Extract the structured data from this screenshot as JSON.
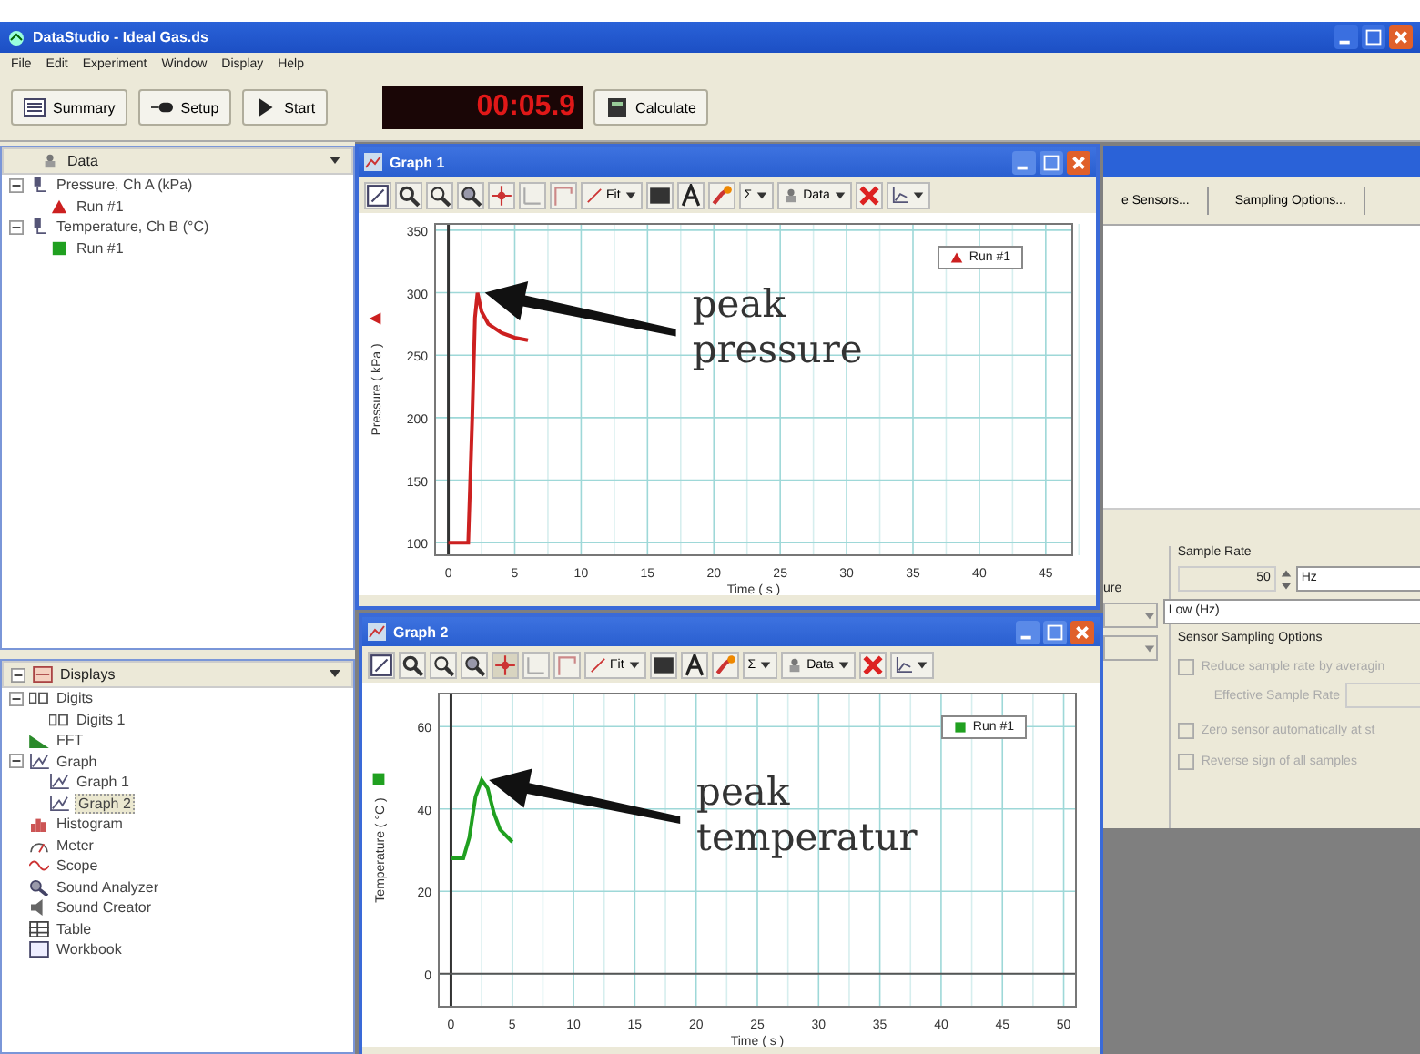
{
  "window": {
    "title": "DataStudio - Ideal Gas.ds"
  },
  "menu": [
    "File",
    "Edit",
    "Experiment",
    "Window",
    "Display",
    "Help"
  ],
  "toolbar": {
    "buttons": [
      {
        "kind": "summary",
        "label": "Summary"
      },
      {
        "kind": "setup",
        "label": "Setup"
      },
      {
        "kind": "start",
        "label": "Start"
      }
    ],
    "timer": "00:05.9",
    "calculate": "Calculate"
  },
  "data_panel": {
    "title": "Data",
    "items": [
      {
        "kind": "sensor",
        "label": "Pressure, Ch A (kPa)",
        "expanded": true,
        "children": [
          {
            "kind": "triangle",
            "label": "Run #1",
            "color": "#cc2020"
          }
        ]
      },
      {
        "kind": "sensor",
        "label": "Temperature, Ch B (°C)",
        "expanded": true,
        "children": [
          {
            "kind": "square",
            "label": "Run #1",
            "color": "#20a020"
          }
        ]
      }
    ]
  },
  "displays_panel": {
    "title": "Displays",
    "items": [
      {
        "kind": "digits",
        "label": "Digits",
        "selected": false,
        "expanded": true,
        "children": [
          {
            "kind": "digits",
            "label": "Digits 1",
            "selected": false
          }
        ]
      },
      {
        "kind": "fft",
        "label": "FFT",
        "selected": false
      },
      {
        "kind": "graph",
        "label": "Graph",
        "selected": false,
        "expanded": true,
        "children": [
          {
            "kind": "graph",
            "label": "Graph 1",
            "selected": false
          },
          {
            "kind": "graph",
            "label": "Graph 2",
            "selected": true
          }
        ]
      },
      {
        "kind": "histogram",
        "label": "Histogram",
        "selected": false
      },
      {
        "kind": "meter",
        "label": "Meter",
        "selected": false
      },
      {
        "kind": "scope",
        "label": "Scope",
        "selected": false
      },
      {
        "kind": "analyzer",
        "label": "Sound Analyzer",
        "selected": false
      },
      {
        "kind": "creator",
        "label": "Sound Creator",
        "selected": false
      },
      {
        "kind": "table",
        "label": "Table",
        "selected": false
      },
      {
        "kind": "workbook",
        "label": "Workbook",
        "selected": false
      }
    ]
  },
  "graphs": [
    {
      "title": "Graph 1",
      "tools": {
        "fit": "Fit",
        "sigma": "Σ",
        "data": "Data"
      },
      "legend": {
        "kind": "triangle"
      },
      "chart_data": {
        "type": "line",
        "xlabel": "Time ( s )",
        "ylabel": "Pressure ( kPa )",
        "grid": true,
        "x": [
          0,
          0.5,
          1,
          1.5,
          1.8,
          2,
          2.2,
          2.5,
          3,
          4,
          5,
          6
        ],
        "series": [
          {
            "name": "Run #1",
            "color": "#cc2020",
            "values": [
              100,
              100,
              100,
              100,
              200,
              280,
              300,
              285,
              275,
              268,
              264,
              262
            ]
          }
        ],
        "xlim": [
          -1,
          47
        ],
        "ylim": [
          90,
          355
        ],
        "xticks": [
          0,
          5,
          10,
          15,
          20,
          25,
          30,
          35,
          40,
          45
        ],
        "yticks": [
          100,
          150,
          200,
          250,
          300,
          350
        ],
        "ref_lines": [
          {
            "axis": "x",
            "value": 0
          }
        ],
        "annotations": [
          "peak pressure"
        ]
      }
    },
    {
      "title": "Graph 2",
      "tools": {
        "fit": "Fit",
        "sigma": "Σ",
        "data": "Data"
      },
      "legend": {
        "kind": "square"
      },
      "chart_data": {
        "type": "line",
        "xlabel": "Time ( s )",
        "ylabel": "Temperature ( °C )",
        "grid": true,
        "x": [
          0,
          0.5,
          1,
          1.5,
          2,
          2.5,
          3,
          3.5,
          4,
          5
        ],
        "series": [
          {
            "name": "Run #1",
            "color": "#20a020",
            "values": [
              28,
              28,
              28,
              33,
              43,
              47,
              45,
              39,
              35,
              32
            ]
          }
        ],
        "xlim": [
          -1,
          51
        ],
        "ylim": [
          -8,
          68
        ],
        "xticks": [
          0,
          5,
          10,
          15,
          20,
          25,
          30,
          35,
          40,
          45,
          50
        ],
        "yticks": [
          0,
          20,
          40,
          60
        ],
        "ref_lines": [
          {
            "axis": "x",
            "value": 0
          },
          {
            "axis": "y",
            "value": 0
          }
        ],
        "annotations": [
          "peak temperatur"
        ]
      }
    }
  ],
  "setup": {
    "buttons": [
      "e Sensors...",
      "Sampling Options..."
    ],
    "cut_label": "ure",
    "sample_rate": {
      "title": "Sample Rate",
      "value": "50",
      "unit": "Hz"
    },
    "mode": "Low (Hz)",
    "sensor_options": {
      "title": "Sensor Sampling Options",
      "effective_rate": "Effective Sample Rate",
      "options": [
        {
          "label": "Reduce sample rate by averagin",
          "checked": false,
          "disabled": true
        },
        {
          "label": "Zero sensor automatically at st",
          "checked": false,
          "disabled": true
        },
        {
          "label": "Reverse sign of all samples",
          "checked": false,
          "disabled": true
        }
      ]
    }
  }
}
